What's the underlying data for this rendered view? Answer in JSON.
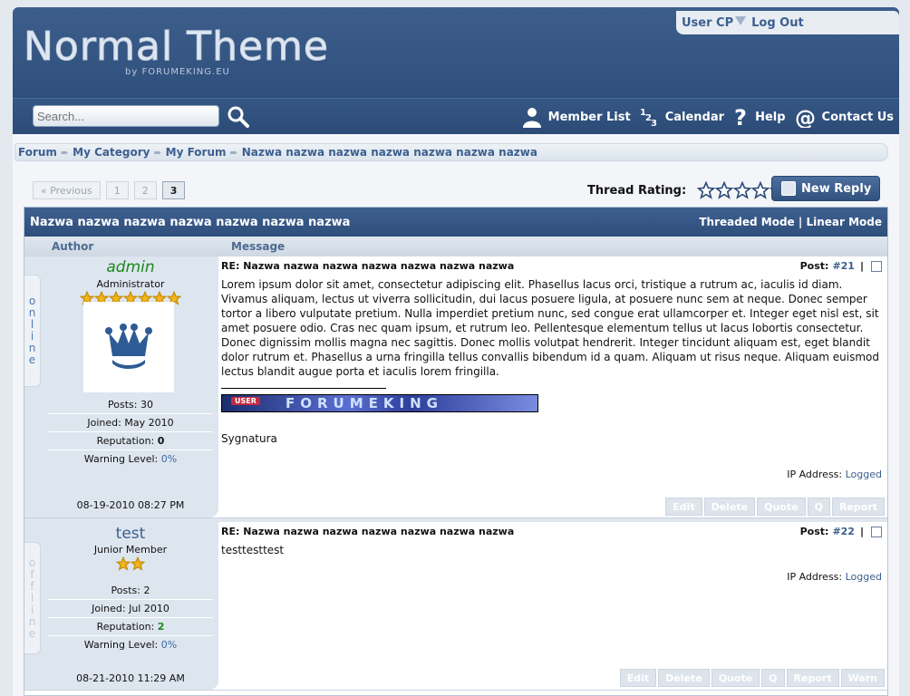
{
  "header": {
    "title": "Normal Theme",
    "subtitle": "by FORUMEKING.EU",
    "user_cp": "User CP",
    "log_out": "Log Out"
  },
  "nav": {
    "search_placeholder": "Search...",
    "member_list": "Member List",
    "calendar": "Calendar",
    "help": "Help",
    "contact_us": "Contact Us"
  },
  "breadcrumb": [
    "Forum",
    "My Category",
    "My Forum",
    "Nazwa nazwa nazwa nazwa nazwa nazwa nazwa"
  ],
  "pagination": {
    "previous": "« Previous",
    "pages": [
      "1",
      "2",
      "3"
    ],
    "current": "3"
  },
  "thread_rating": {
    "label": "Thread Rating:",
    "stars": 5
  },
  "new_reply": "New Reply",
  "thread": {
    "title": "Nazwa nazwa nazwa nazwa nazwa nazwa nazwa",
    "threaded_mode": "Threaded Mode",
    "separator": "|",
    "linear_mode": "Linear Mode",
    "col_author": "Author",
    "col_message": "Message"
  },
  "posts": [
    {
      "status": "online",
      "username": "admin",
      "user_title": "Administrator",
      "stars": 7,
      "stats": {
        "posts_label": "Posts:",
        "posts": "30",
        "joined_label": "Joined:",
        "joined": "May 2010",
        "reputation_label": "Reputation:",
        "reputation": "0",
        "warning_label": "Warning Level:",
        "warning": "0%"
      },
      "date": "08-19-2010 08:27 PM",
      "subject": "RE: Nazwa nazwa nazwa nazwa nazwa nazwa nazwa",
      "post_label": "Post:",
      "post_number": "#21",
      "body": "Lorem ipsum dolor sit amet, consectetur adipiscing elit. Phasellus lacus orci, tristique a rutrum ac, iaculis id diam. Vivamus aliquam, lectus ut viverra sollicitudin, dui lacus posuere ligula, at posuere nunc sem at neque. Donec semper tortor a libero vulputate pretium. Nulla imperdiet pretium nunc, sed congue erat ullamcorper et. Integer eget nisl est, sit amet posuere odio. Cras nec quam ipsum, et rutrum leo. Pellentesque elementum tellus ut lacus lobortis consectetur. Donec dignissim mollis magna nec sagittis. Donec mollis volutpat hendrerit. Integer tincidunt aliquam est, eget blandit dolor rutrum et. Phasellus a urna fringilla tellus convallis bibendum id a quam. Aliquam ut risus neque. Aliquam euismod lectus blandit augue porta et iaculis lorem fringilla.",
      "signature": "Sygnatura",
      "ip_label": "IP Address:",
      "ip_value": "Logged",
      "actions": [
        "Edit",
        "Delete",
        "Quote",
        "Q",
        "Report"
      ]
    },
    {
      "status": "offline",
      "username": "test",
      "user_title": "Junior Member",
      "stars": 2,
      "stats": {
        "posts_label": "Posts:",
        "posts": "2",
        "joined_label": "Joined:",
        "joined": "Jul 2010",
        "reputation_label": "Reputation:",
        "reputation": "2",
        "warning_label": "Warning Level:",
        "warning": "0%"
      },
      "date": "08-21-2010 11:29 AM",
      "subject": "RE: Nazwa nazwa nazwa nazwa nazwa nazwa nazwa",
      "post_label": "Post:",
      "post_number": "#22",
      "body": "testtesttest",
      "ip_label": "IP Address:",
      "ip_value": "Logged",
      "actions": [
        "Edit",
        "Delete",
        "Quote",
        "Q",
        "Report",
        "Warn"
      ]
    }
  ],
  "colors": {
    "header_blue": "#2f4f7c",
    "link_blue": "#3b5f8f",
    "admin_green": "#1b8a1b",
    "rep_green": "#1b8a1b"
  }
}
